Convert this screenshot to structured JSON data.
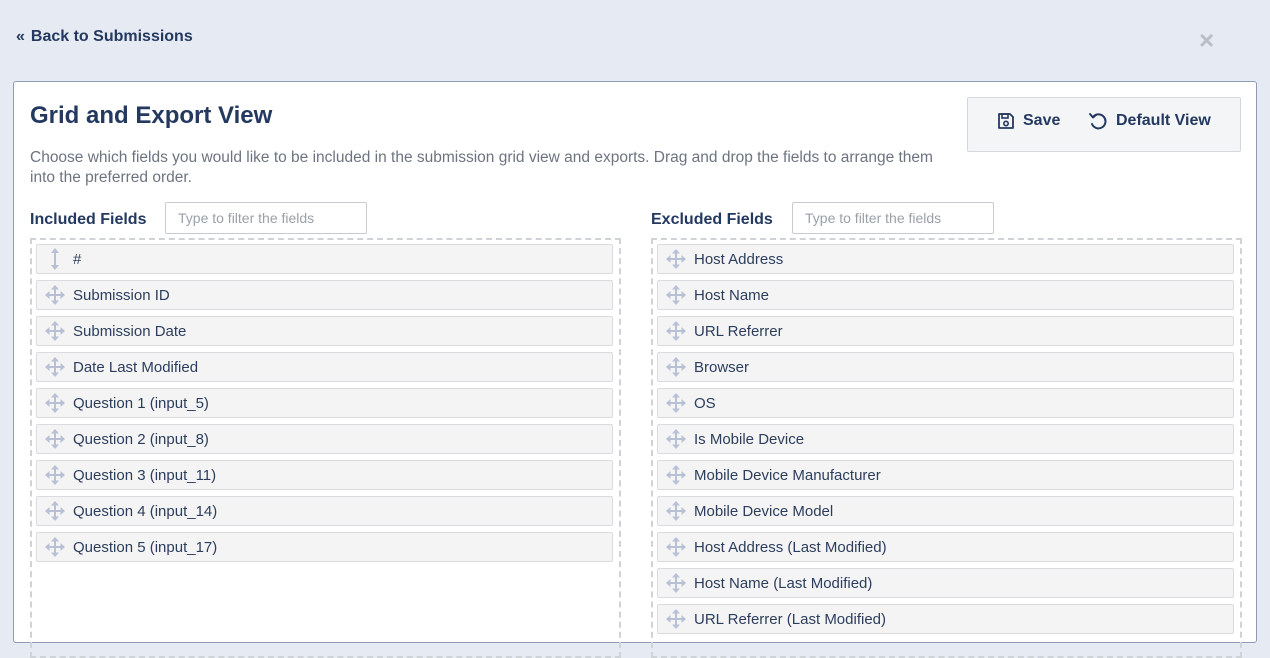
{
  "header": {
    "back_label": "Back to Submissions",
    "back_icon": "double-chevron-left-icon",
    "close_icon": "close-icon"
  },
  "panel": {
    "title": "Grid and Export View",
    "description": "Choose which fields you would like to be included in the submission grid view and exports. Drag and drop the fields to arrange them into the preferred order.",
    "save_label": "Save",
    "default_view_label": "Default View"
  },
  "included": {
    "label": "Included Fields",
    "filter_placeholder": "Type to filter the fields",
    "items": [
      {
        "label": "#",
        "icon": "vertical-resize-icon"
      },
      {
        "label": "Submission ID",
        "icon": "move-icon"
      },
      {
        "label": "Submission Date",
        "icon": "move-icon"
      },
      {
        "label": "Date Last Modified",
        "icon": "move-icon"
      },
      {
        "label": "Question 1 (input_5)",
        "icon": "move-icon"
      },
      {
        "label": "Question 2 (input_8)",
        "icon": "move-icon"
      },
      {
        "label": "Question 3 (input_11)",
        "icon": "move-icon"
      },
      {
        "label": "Question 4 (input_14)",
        "icon": "move-icon"
      },
      {
        "label": "Question 5 (input_17)",
        "icon": "move-icon"
      }
    ]
  },
  "excluded": {
    "label": "Excluded Fields",
    "filter_placeholder": "Type to filter the fields",
    "items": [
      {
        "label": "Host Address",
        "icon": "move-icon"
      },
      {
        "label": "Host Name",
        "icon": "move-icon"
      },
      {
        "label": "URL Referrer",
        "icon": "move-icon"
      },
      {
        "label": "Browser",
        "icon": "move-icon"
      },
      {
        "label": "OS",
        "icon": "move-icon"
      },
      {
        "label": "Is Mobile Device",
        "icon": "move-icon"
      },
      {
        "label": "Mobile Device Manufacturer",
        "icon": "move-icon"
      },
      {
        "label": "Mobile Device Model",
        "icon": "move-icon"
      },
      {
        "label": "Host Address (Last Modified)",
        "icon": "move-icon"
      },
      {
        "label": "Host Name (Last Modified)",
        "icon": "move-icon"
      },
      {
        "label": "URL Referrer (Last Modified)",
        "icon": "move-icon"
      }
    ]
  },
  "colors": {
    "heading": "#24395f",
    "handle": "#b8c0d6",
    "background": "#e6eaf2"
  }
}
